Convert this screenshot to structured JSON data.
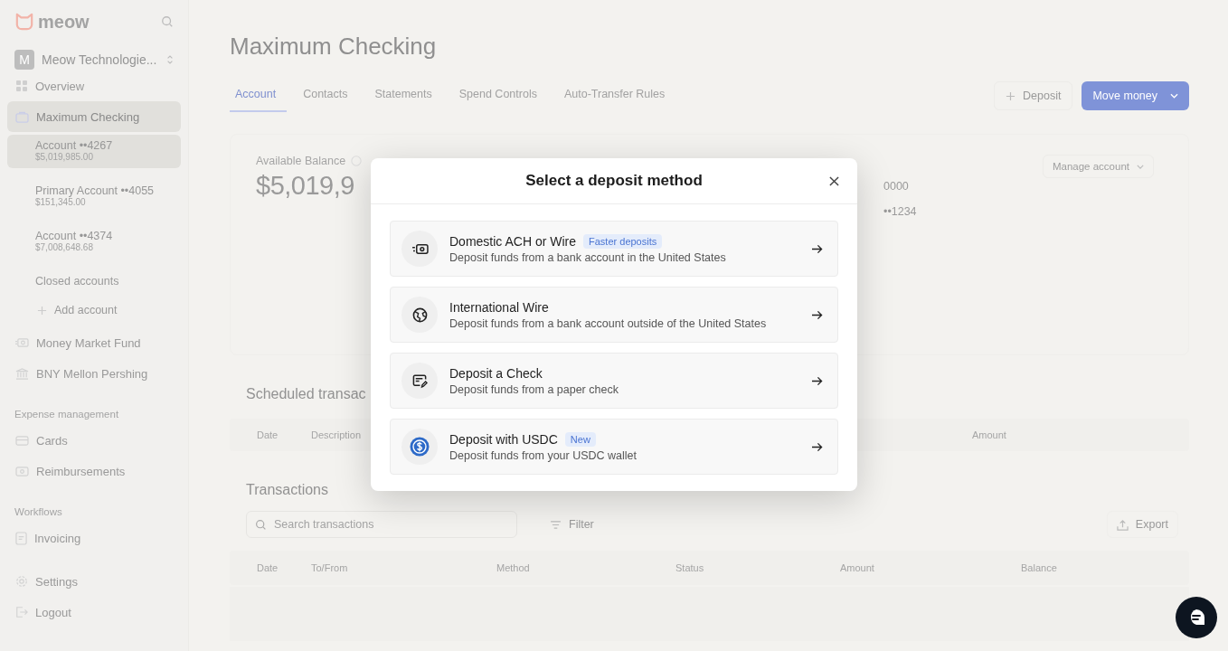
{
  "sidebar": {
    "logo": "meow",
    "org": {
      "initial": "M",
      "name": "Meow Technologie..."
    },
    "items": [
      {
        "kind": "nav",
        "label": "Overview",
        "selected": false
      },
      {
        "kind": "nav",
        "label": "Maximum Checking",
        "selected": true
      },
      {
        "kind": "account",
        "label": "Account ••4267",
        "amount": "$5,019,985.00",
        "selected": true
      },
      {
        "kind": "account",
        "label": "Primary Account ••4055",
        "amount": "$151,345.00",
        "selected": false
      },
      {
        "kind": "account",
        "label": "Account ••4374",
        "amount": "$7,008,648.68",
        "selected": false
      },
      {
        "kind": "link",
        "label": "Closed accounts",
        "selected": false
      },
      {
        "kind": "add",
        "label": "Add account",
        "selected": false
      },
      {
        "kind": "nav",
        "label": "Money Market Fund",
        "selected": false
      },
      {
        "kind": "nav",
        "label": "BNY Mellon Pershing",
        "selected": false
      },
      {
        "kind": "section",
        "label": "Expense management"
      },
      {
        "kind": "nav",
        "label": "Cards",
        "selected": false
      },
      {
        "kind": "nav",
        "label": "Reimbursements",
        "selected": false
      },
      {
        "kind": "section",
        "label": "Workflows"
      },
      {
        "kind": "nav",
        "label": "Invoicing",
        "selected": false
      }
    ],
    "bottom_items": [
      {
        "label": "Settings"
      },
      {
        "label": "Logout"
      }
    ]
  },
  "page": {
    "title": "Maximum Checking",
    "tabs": [
      {
        "label": "Account",
        "selected": true
      },
      {
        "label": "Contacts",
        "selected": false
      },
      {
        "label": "Statements",
        "selected": false
      },
      {
        "label": "Spend Controls",
        "selected": false
      },
      {
        "label": "Auto-Transfer Rules",
        "selected": false
      }
    ],
    "deposit_button": "Deposit",
    "move_money_button": "Move money",
    "balance": {
      "label": "Available Balance",
      "amount": "$5,019,9",
      "manage_button": "Manage account",
      "details": [
        "0000",
        "••1234"
      ]
    },
    "scheduled": {
      "title": "Scheduled transac",
      "columns": [
        "Date",
        "Description",
        "Amount"
      ]
    },
    "transactions": {
      "title": "Transactions",
      "search": {
        "placeholder": "Search transactions"
      },
      "filter": "Filter",
      "export": "Export",
      "columns": [
        "Date",
        "To/From",
        "Method",
        "Status",
        "Amount",
        "Balance"
      ]
    }
  },
  "modal": {
    "title": "Select a deposit method",
    "options": [
      {
        "title": "Domestic ACH or Wire",
        "badge": "Faster deposits",
        "description": "Deposit funds from a bank account in the United States"
      },
      {
        "title": "International Wire",
        "description": "Deposit funds from a bank account outside of the United States"
      },
      {
        "title": "Deposit a Check",
        "description": "Deposit funds from a paper check"
      },
      {
        "title": "Deposit with USDC",
        "badge": "New",
        "description": "Deposit funds from your USDC wallet"
      }
    ]
  }
}
